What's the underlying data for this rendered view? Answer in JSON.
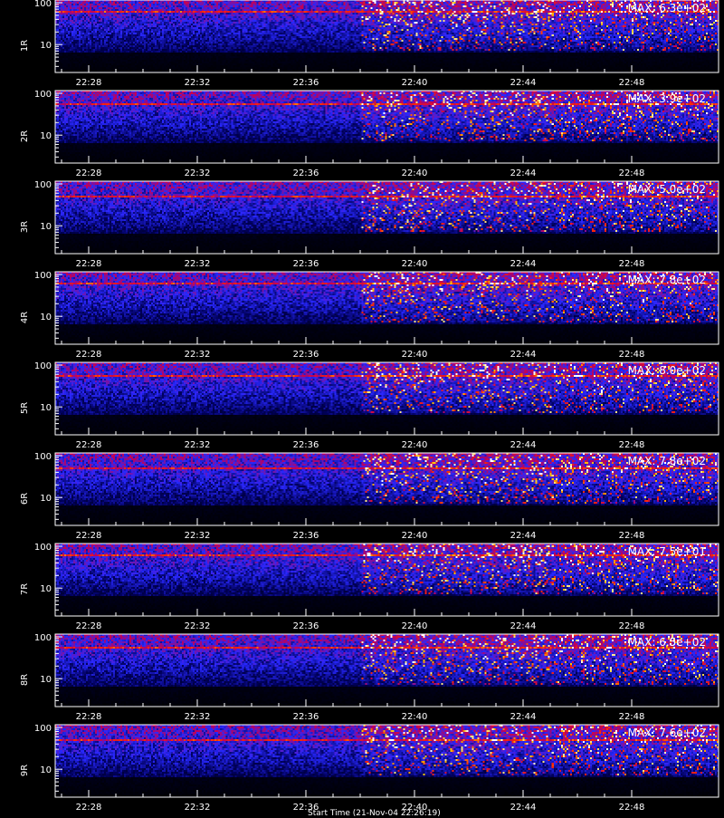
{
  "chart_data": {
    "type": "heatmap",
    "xlabel": "Start Time (21-Nov-04 22:26:19)",
    "x_ticks": [
      "22:28",
      "22:32",
      "22:36",
      "22:40",
      "22:44",
      "22:48"
    ],
    "y_scale": "log",
    "y_ticks": [
      "10",
      "100"
    ],
    "colors": {
      "low": "#000000",
      "mid": "#2b2bff",
      "high": "#ff3300",
      "peak": "#ffffff",
      "axis": "#ffffff"
    },
    "panels": [
      {
        "label": "1R",
        "max_text": "MAX: 6.3e+02"
      },
      {
        "label": "2R",
        "max_text": "MAX: 3.9e+02"
      },
      {
        "label": "3R",
        "max_text": "MAX: 5.0e+02"
      },
      {
        "label": "4R",
        "max_text": "MAX: 7.8e+02"
      },
      {
        "label": "5R",
        "max_text": "MAX: 8.0e+02"
      },
      {
        "label": "6R",
        "max_text": "MAX: 7.8e+02"
      },
      {
        "label": "7R",
        "max_text": "MAX: 7.5e+01"
      },
      {
        "label": "8R",
        "max_text": "MAX: 6.5e+02"
      },
      {
        "label": "9R",
        "max_text": "MAX: 7.6e+02"
      }
    ]
  }
}
